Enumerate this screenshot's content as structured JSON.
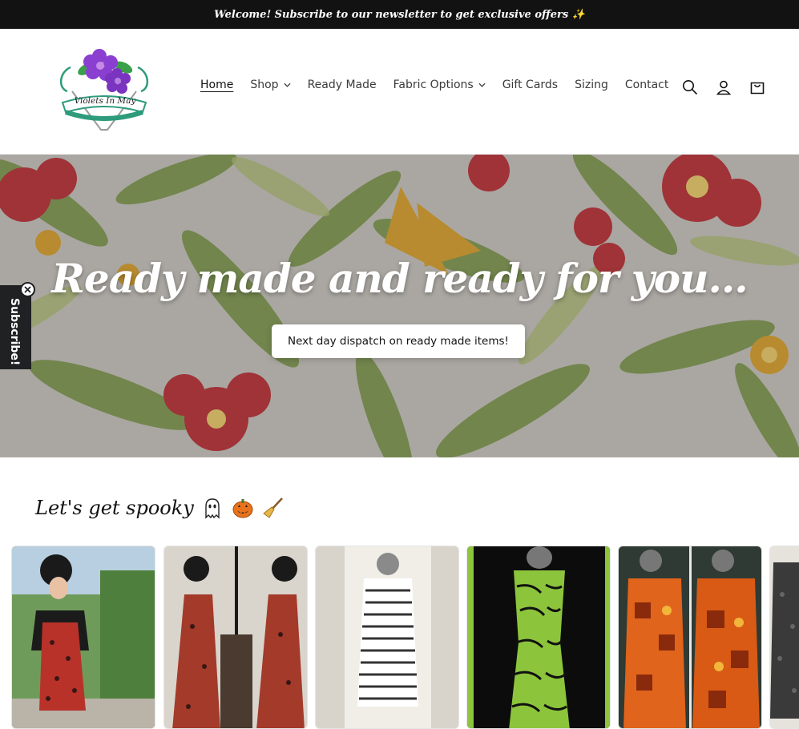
{
  "announcement": {
    "text": "Welcome! Subscribe to our newsletter to get exclusive offers ✨"
  },
  "brand": {
    "logo_text": "Violets In May"
  },
  "nav": {
    "items": [
      {
        "label": "Home",
        "active": true,
        "dropdown": false
      },
      {
        "label": "Shop",
        "active": false,
        "dropdown": true
      },
      {
        "label": "Ready Made",
        "active": false,
        "dropdown": false
      },
      {
        "label": "Fabric Options",
        "active": false,
        "dropdown": true
      },
      {
        "label": "Gift Cards",
        "active": false,
        "dropdown": false
      },
      {
        "label": "Sizing",
        "active": false,
        "dropdown": false
      },
      {
        "label": "Contact",
        "active": false,
        "dropdown": false
      }
    ]
  },
  "header_icons": [
    "search-icon",
    "account-icon",
    "cart-icon"
  ],
  "hero": {
    "title": "Ready made and ready for you...",
    "button_label": "Next day dispatch on ready made items!"
  },
  "subscribe_tab": {
    "label": "Subscribe!"
  },
  "collection": {
    "title": "Let's get spooky",
    "emojis": [
      "ghost",
      "jack-o-lantern",
      "broom"
    ]
  },
  "products": [
    {
      "name": "leopard-dress-with-jacket",
      "accent": "#b8322a"
    },
    {
      "name": "leopard-jumpsuit",
      "accent": "#a33a2a"
    },
    {
      "name": "striped-halter-playsuit",
      "accent": "#333333"
    },
    {
      "name": "green-zebra-dress",
      "accent": "#8cc43c"
    },
    {
      "name": "orange-tiki-dress",
      "accent": "#e0641c"
    },
    {
      "name": "grey-dress",
      "accent": "#666666"
    }
  ],
  "colors": {
    "announcement_bg": "#121212",
    "subscribe_tab_bg": "#1f2123",
    "logo_accent": "#2e9c7c",
    "logo_flower": "#8a3fd0"
  }
}
